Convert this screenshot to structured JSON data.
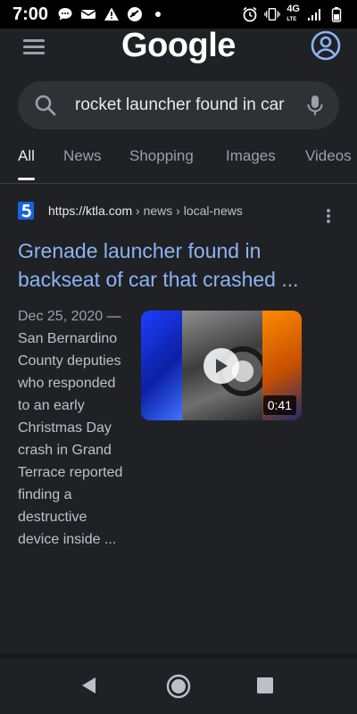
{
  "status_bar": {
    "time": "7:00",
    "network": "4G",
    "network_sub": "LTE",
    "icons_left": [
      "chat-bubble-icon",
      "voicemail-icon",
      "warning-icon",
      "no-disturb-icon",
      "dot-icon"
    ],
    "icons_right": [
      "alarm-icon",
      "vibrate-icon",
      "signal-icon",
      "battery-icon"
    ]
  },
  "header": {
    "logo": "Google"
  },
  "search": {
    "query": "rocket launcher found in car"
  },
  "tabs": [
    {
      "label": "All",
      "active": true
    },
    {
      "label": "News",
      "active": false
    },
    {
      "label": "Shopping",
      "active": false
    },
    {
      "label": "Images",
      "active": false
    },
    {
      "label": "Videos",
      "active": false
    }
  ],
  "result": {
    "url_host": "https://ktla.com",
    "url_path": " › news › local-news",
    "title": "Grenade launcher found in backseat of car that crashed ...",
    "date": "Dec 25, 2020",
    "snippet": " — San Bernardino County deputies who responded to an early Christmas Day crash in Grand Terrace reported finding a destructive device inside ...",
    "video_duration": "0:41"
  },
  "colors": {
    "background": "#202124",
    "link": "#8ab4f8",
    "account_icon": "#8ab4f8"
  }
}
